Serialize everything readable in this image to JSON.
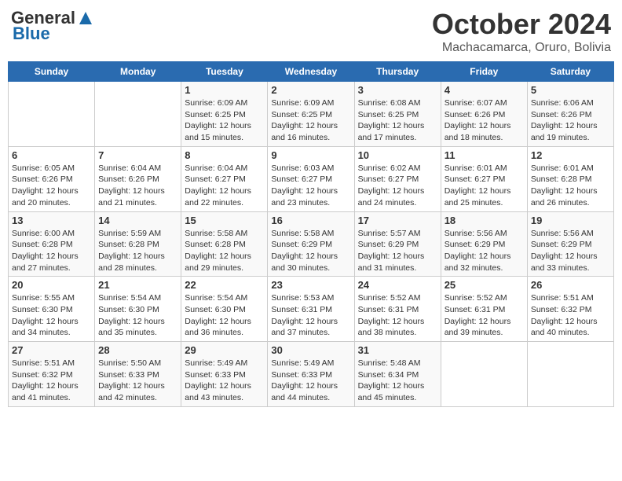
{
  "logo": {
    "general": "General",
    "blue": "Blue"
  },
  "title": "October 2024",
  "subtitle": "Machacamarca, Oruro, Bolivia",
  "weekdays": [
    "Sunday",
    "Monday",
    "Tuesday",
    "Wednesday",
    "Thursday",
    "Friday",
    "Saturday"
  ],
  "weeks": [
    [
      {
        "day": "",
        "info": ""
      },
      {
        "day": "",
        "info": ""
      },
      {
        "day": "1",
        "info": "Sunrise: 6:09 AM\nSunset: 6:25 PM\nDaylight: 12 hours and 15 minutes."
      },
      {
        "day": "2",
        "info": "Sunrise: 6:09 AM\nSunset: 6:25 PM\nDaylight: 12 hours and 16 minutes."
      },
      {
        "day": "3",
        "info": "Sunrise: 6:08 AM\nSunset: 6:25 PM\nDaylight: 12 hours and 17 minutes."
      },
      {
        "day": "4",
        "info": "Sunrise: 6:07 AM\nSunset: 6:26 PM\nDaylight: 12 hours and 18 minutes."
      },
      {
        "day": "5",
        "info": "Sunrise: 6:06 AM\nSunset: 6:26 PM\nDaylight: 12 hours and 19 minutes."
      }
    ],
    [
      {
        "day": "6",
        "info": "Sunrise: 6:05 AM\nSunset: 6:26 PM\nDaylight: 12 hours and 20 minutes."
      },
      {
        "day": "7",
        "info": "Sunrise: 6:04 AM\nSunset: 6:26 PM\nDaylight: 12 hours and 21 minutes."
      },
      {
        "day": "8",
        "info": "Sunrise: 6:04 AM\nSunset: 6:27 PM\nDaylight: 12 hours and 22 minutes."
      },
      {
        "day": "9",
        "info": "Sunrise: 6:03 AM\nSunset: 6:27 PM\nDaylight: 12 hours and 23 minutes."
      },
      {
        "day": "10",
        "info": "Sunrise: 6:02 AM\nSunset: 6:27 PM\nDaylight: 12 hours and 24 minutes."
      },
      {
        "day": "11",
        "info": "Sunrise: 6:01 AM\nSunset: 6:27 PM\nDaylight: 12 hours and 25 minutes."
      },
      {
        "day": "12",
        "info": "Sunrise: 6:01 AM\nSunset: 6:28 PM\nDaylight: 12 hours and 26 minutes."
      }
    ],
    [
      {
        "day": "13",
        "info": "Sunrise: 6:00 AM\nSunset: 6:28 PM\nDaylight: 12 hours and 27 minutes."
      },
      {
        "day": "14",
        "info": "Sunrise: 5:59 AM\nSunset: 6:28 PM\nDaylight: 12 hours and 28 minutes."
      },
      {
        "day": "15",
        "info": "Sunrise: 5:58 AM\nSunset: 6:28 PM\nDaylight: 12 hours and 29 minutes."
      },
      {
        "day": "16",
        "info": "Sunrise: 5:58 AM\nSunset: 6:29 PM\nDaylight: 12 hours and 30 minutes."
      },
      {
        "day": "17",
        "info": "Sunrise: 5:57 AM\nSunset: 6:29 PM\nDaylight: 12 hours and 31 minutes."
      },
      {
        "day": "18",
        "info": "Sunrise: 5:56 AM\nSunset: 6:29 PM\nDaylight: 12 hours and 32 minutes."
      },
      {
        "day": "19",
        "info": "Sunrise: 5:56 AM\nSunset: 6:29 PM\nDaylight: 12 hours and 33 minutes."
      }
    ],
    [
      {
        "day": "20",
        "info": "Sunrise: 5:55 AM\nSunset: 6:30 PM\nDaylight: 12 hours and 34 minutes."
      },
      {
        "day": "21",
        "info": "Sunrise: 5:54 AM\nSunset: 6:30 PM\nDaylight: 12 hours and 35 minutes."
      },
      {
        "day": "22",
        "info": "Sunrise: 5:54 AM\nSunset: 6:30 PM\nDaylight: 12 hours and 36 minutes."
      },
      {
        "day": "23",
        "info": "Sunrise: 5:53 AM\nSunset: 6:31 PM\nDaylight: 12 hours and 37 minutes."
      },
      {
        "day": "24",
        "info": "Sunrise: 5:52 AM\nSunset: 6:31 PM\nDaylight: 12 hours and 38 minutes."
      },
      {
        "day": "25",
        "info": "Sunrise: 5:52 AM\nSunset: 6:31 PM\nDaylight: 12 hours and 39 minutes."
      },
      {
        "day": "26",
        "info": "Sunrise: 5:51 AM\nSunset: 6:32 PM\nDaylight: 12 hours and 40 minutes."
      }
    ],
    [
      {
        "day": "27",
        "info": "Sunrise: 5:51 AM\nSunset: 6:32 PM\nDaylight: 12 hours and 41 minutes."
      },
      {
        "day": "28",
        "info": "Sunrise: 5:50 AM\nSunset: 6:33 PM\nDaylight: 12 hours and 42 minutes."
      },
      {
        "day": "29",
        "info": "Sunrise: 5:49 AM\nSunset: 6:33 PM\nDaylight: 12 hours and 43 minutes."
      },
      {
        "day": "30",
        "info": "Sunrise: 5:49 AM\nSunset: 6:33 PM\nDaylight: 12 hours and 44 minutes."
      },
      {
        "day": "31",
        "info": "Sunrise: 5:48 AM\nSunset: 6:34 PM\nDaylight: 12 hours and 45 minutes."
      },
      {
        "day": "",
        "info": ""
      },
      {
        "day": "",
        "info": ""
      }
    ]
  ]
}
